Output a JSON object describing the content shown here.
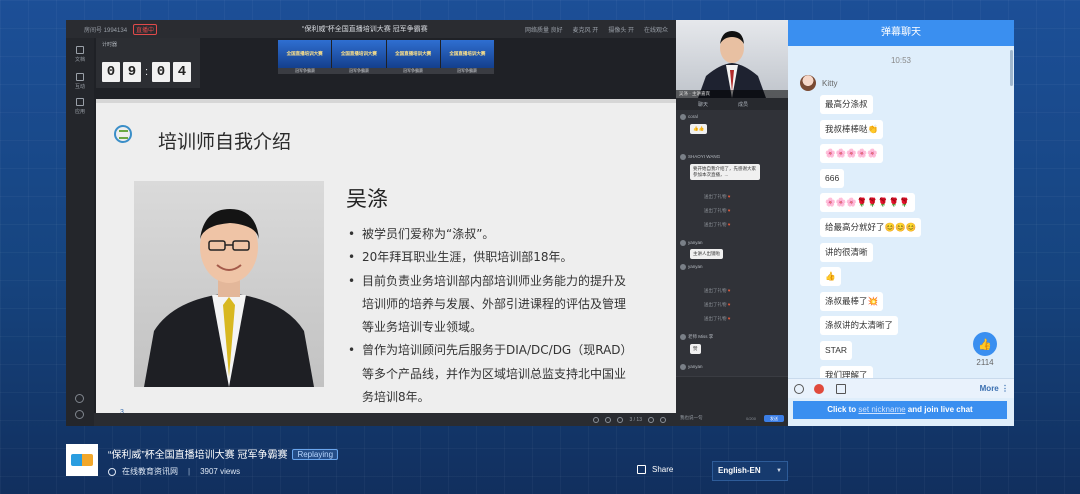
{
  "player": {
    "topbar": {
      "room_id": "房间号 1994134",
      "live_status": "直播中",
      "title": "“保利威”杯全国直播培训大赛 冠军争霸赛",
      "tools": [
        "网络质量 良好",
        "麦克风 开",
        "摄像头 开",
        "在线观众"
      ]
    },
    "leftbar": {
      "items": [
        "文档",
        "互动",
        "应用"
      ]
    },
    "timer": {
      "label": "计时器",
      "digits": [
        "0",
        "9",
        "0",
        "4"
      ]
    },
    "banner": {
      "cells": [
        "全国直播培训大赛",
        "全国直播培训大赛",
        "全国直播培训大赛",
        "全国直播培训大赛"
      ],
      "strip": [
        "冠军争霸赛",
        "冠军争霸赛",
        "冠军争霸赛",
        "冠军争霸赛"
      ]
    },
    "slide": {
      "title": "培训师自我介绍",
      "name": "吴涤",
      "bullets": [
        "被学员们爱称为“涤叔”。",
        "20年拜耳职业生涯，供职培训部18年。",
        "目前负责业务培训部内部培训师业务能力的提升及培训师的培养与发展、外部引进课程的评估及管理等业务培训专业领域。",
        "曾作为培训顾问先后服务于DIA/DC/DG（现RAD）等多个产品线，并作为区域培训总监支持北中国业务培训8年。"
      ],
      "page": "3"
    },
    "controls": {
      "page_indicator": "3 / 13"
    },
    "cam": {
      "caption": "吴涤 · 主讲嘉宾"
    },
    "inner_chat": {
      "tabs": [
        "聊天",
        "成员"
      ],
      "messages": [
        {
          "user": "coral",
          "text": "👍👍"
        },
        {
          "user": "SHAOYI WANG",
          "text": "要开始自我介绍了，先感谢大家参加本次直播，..."
        },
        {
          "user": "yanyan",
          "text": "主讲人出镜啦"
        },
        {
          "user": "yanyan",
          "text": "赞"
        },
        {
          "user": "老师 Miss 李",
          "text": "赞"
        },
        {
          "user": "yanyan",
          "text": "好"
        }
      ],
      "system_lines": [
        "送出了礼物",
        "送出了礼物",
        "送出了礼物",
        "送出了礼物",
        "送出了礼物",
        "送出了礼物"
      ],
      "input_hint": "我也说一句",
      "count": "0/200",
      "send_label": "发送"
    }
  },
  "chat": {
    "header": "弹幕聊天",
    "time": "10:53",
    "username": "Kitty",
    "messages": [
      "最高分涤叔",
      "我叔棒棒哒",
      "🌸🌸🌸🌸🌸",
      "666",
      "🌸🌸🌸🌹🌹🌹🌹🌹",
      "给最高分就好了",
      "讲的很清晰",
      "👍",
      "涤叔最棒了",
      "涤叔讲的太清晰了",
      "STAR",
      "我们理解了"
    ],
    "emoji_suffix": {
      "1": "👏",
      "5": "😊😊😊",
      "8": "💥"
    },
    "like_count": "2114",
    "more_label": "More",
    "login": {
      "prefix": "Click to",
      "link": "set nickname",
      "suffix": "and join live chat"
    }
  },
  "info": {
    "title": "“保利威”杯全国直播培训大赛 冠军争霸赛",
    "badge": "Replaying",
    "host": "在线教育资讯网",
    "separator": "|",
    "views": "3907 views",
    "share_label": "Share",
    "language": "English-EN"
  }
}
